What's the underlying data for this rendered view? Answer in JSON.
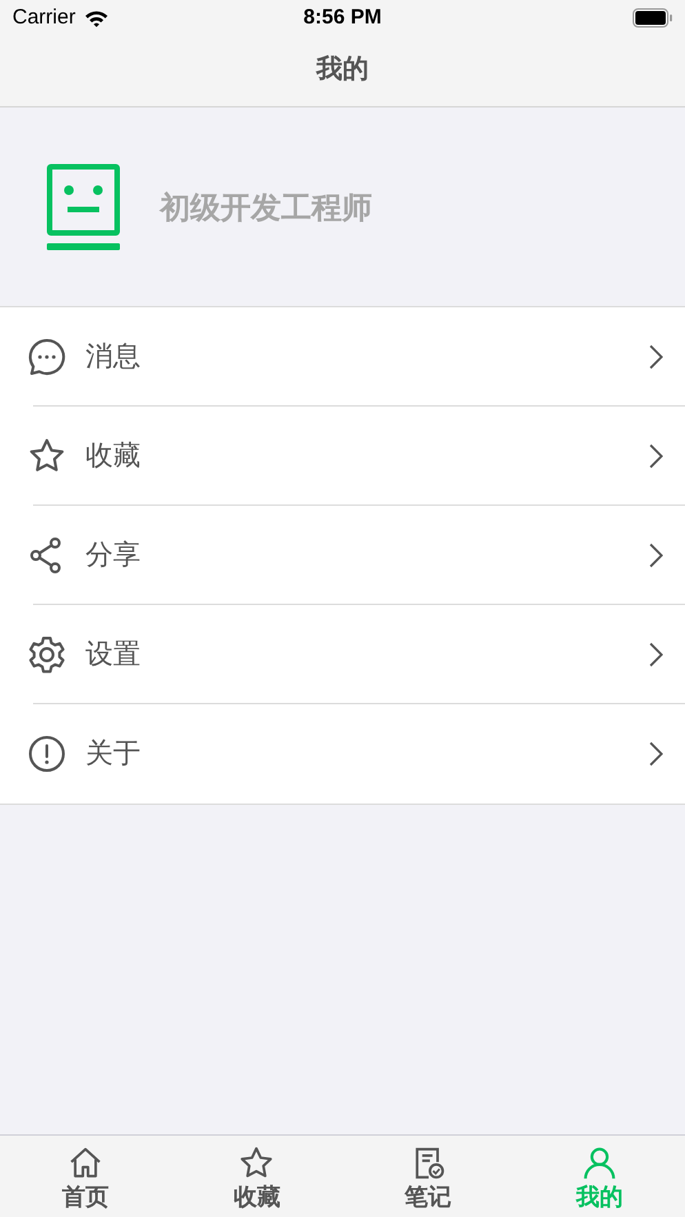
{
  "status_bar": {
    "carrier": "Carrier",
    "time": "8:56 PM"
  },
  "nav_bar": {
    "title": "我的"
  },
  "profile": {
    "name": "初级开发工程师"
  },
  "menu": [
    {
      "label": "消息"
    },
    {
      "label": "收藏"
    },
    {
      "label": "分享"
    },
    {
      "label": "设置"
    },
    {
      "label": "关于"
    }
  ],
  "tabs": [
    {
      "label": "首页",
      "selected": false
    },
    {
      "label": "收藏",
      "selected": false
    },
    {
      "label": "笔记",
      "selected": false
    },
    {
      "label": "我的",
      "selected": true
    }
  ]
}
